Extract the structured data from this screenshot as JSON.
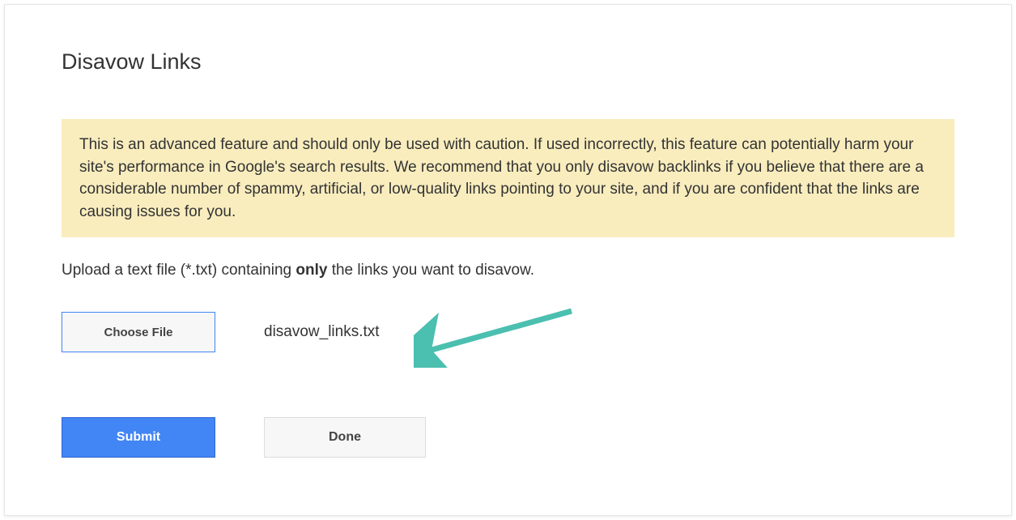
{
  "title": "Disavow Links",
  "warning": "This is an advanced feature and should only be used with caution. If used incorrectly, this feature can potentially harm your site's performance in Google's search results. We recommend that you only disavow backlinks if you believe that there are a considerable number of spammy, artificial, or low-quality links pointing to your site, and if you are confident that the links are causing issues for you.",
  "instruction_prefix": "Upload a text file (*.txt) containing ",
  "instruction_bold": "only",
  "instruction_suffix": " the links you want to disavow.",
  "buttons": {
    "choose_file": "Choose File",
    "submit": "Submit",
    "done": "Done"
  },
  "selected_file": "disavow_links.txt"
}
